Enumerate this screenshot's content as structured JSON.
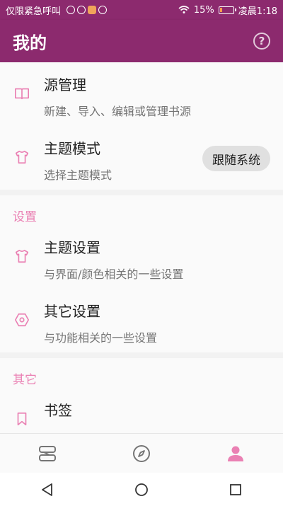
{
  "status_bar": {
    "left_text": "仅限紧急呼叫",
    "battery": "15%",
    "time": "凌晨1:18"
  },
  "app_bar": {
    "title": "我的",
    "help_icon": "help-circle-icon",
    "help_glyph": "?"
  },
  "items": {
    "source": {
      "title": "源管理",
      "subtitle": "新建、导入、编辑或管理书源",
      "icon": "book-open-icon"
    },
    "theme_mode": {
      "title": "主题模式",
      "subtitle": "选择主题模式",
      "value": "跟随系统",
      "icon": "tshirt-icon"
    }
  },
  "settings": {
    "header": "设置",
    "theme": {
      "title": "主题设置",
      "subtitle": "与界面/颜色相关的一些设置",
      "icon": "tshirt-icon"
    },
    "other": {
      "title": "其它设置",
      "subtitle": "与功能相关的一些设置",
      "icon": "gear-icon"
    }
  },
  "others": {
    "header": "其它",
    "bookmark": {
      "title": "书签",
      "icon": "bookmark-icon"
    }
  },
  "bottom_nav": {
    "items": [
      {
        "icon": "bookshelf-icon",
        "active": false
      },
      {
        "icon": "compass-icon",
        "active": false
      },
      {
        "icon": "person-icon",
        "active": true
      }
    ]
  },
  "colors": {
    "primary": "#8c2a6e",
    "accent": "#ea80b3",
    "inactive_icon": "#757575"
  }
}
